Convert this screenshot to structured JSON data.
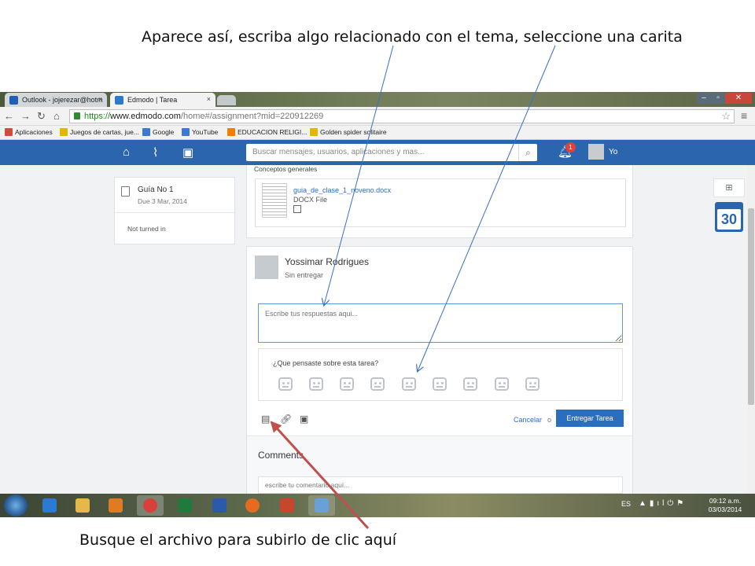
{
  "captions": {
    "top": "Aparece así, escriba algo relacionado con el tema, seleccione una carita",
    "bottom": "Busque el archivo para subirlo de clic aquí"
  },
  "browser": {
    "tabs": [
      {
        "label": "Outlook - jojerezar@hotm",
        "icon": "outlook-icon"
      },
      {
        "label": "Edmodo | Tarea",
        "icon": "edmodo-icon"
      }
    ],
    "close_glyph": "×",
    "url": {
      "scheme": "https://",
      "domain": "www.edmodo.com",
      "path": "/home#/assignment?mid=220912269"
    },
    "bookmarks": [
      {
        "label": "Aplicaciones",
        "color": "#d14b3d"
      },
      {
        "label": "Juegos de cartas, jue...",
        "color": "#e0b800"
      },
      {
        "label": "Google",
        "color": "#3c78d8"
      },
      {
        "label": "YouTube",
        "color": "#3c78d8"
      },
      {
        "label": "EDUCACION RELIGI...",
        "color": "#f57c00"
      },
      {
        "label": "Golden spider solitaire",
        "color": "#e0b800"
      }
    ]
  },
  "edmodo": {
    "search_placeholder": "Buscar mensajes, usuarios, aplicaciones y mas...",
    "notifications_count": "1",
    "user_name": "Yo",
    "assignment": {
      "title": "Guía No 1",
      "due": "Due 3 Mar, 2014",
      "status": "Not turned in"
    },
    "concepts_label": "Conceptos generales",
    "file": {
      "name": "guia_de_clase_1_noveno.docx",
      "type": "DOCX File"
    },
    "response": {
      "student_name": "Yossimar Rodrigues",
      "status": "Sin entregar",
      "answer_placeholder": "Escribe tus respuestas aqui...",
      "reaction_question": "¿Que pensaste sobre esta tarea?",
      "cancel_label": "Cancelar",
      "or_label": "o",
      "submit_label": "Entregar Tarea"
    },
    "comments": {
      "title": "Comments",
      "placeholder": "escribe tu comentario aquí..."
    },
    "calendar_day": "30"
  },
  "taskbar": {
    "language": "ES",
    "time": "09:12 a.m.",
    "date": "03/03/2014"
  },
  "colors": {
    "edmodo_blue": "#2a65ae",
    "link_blue": "#2a6fbf",
    "arrow_blue": "#3a6fc4",
    "arrow_red": "#c0504d"
  }
}
